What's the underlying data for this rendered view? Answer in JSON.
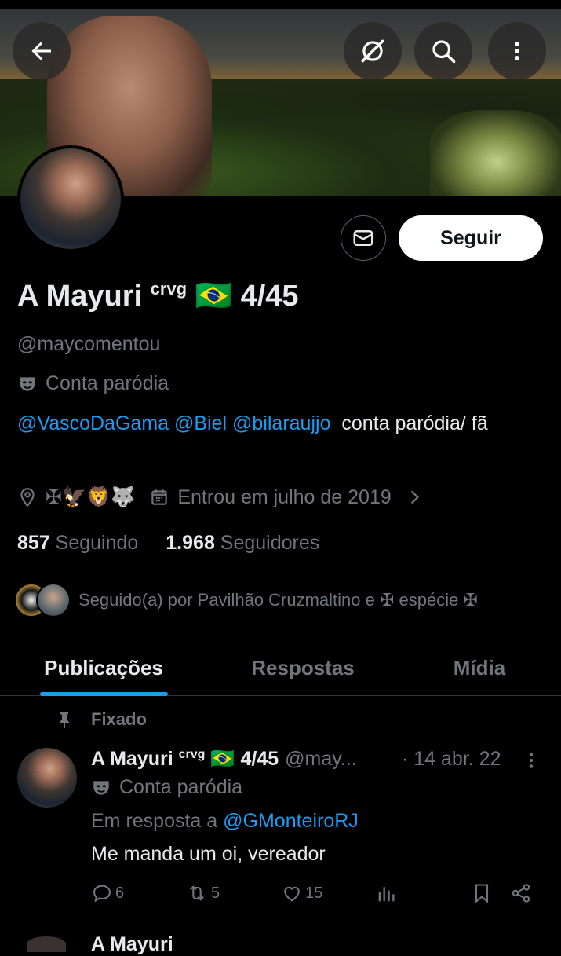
{
  "profile": {
    "name": "A Mayuri",
    "name_sup": "crvg",
    "name_flag": "🇧🇷",
    "name_suffix": "4/45",
    "handle": "@maycomentou",
    "parody_label": "Conta paródia",
    "bio_links": [
      "@VascoDaGama",
      "@Biel",
      "@bilaraujjo"
    ],
    "bio_text": "conta paródia/ fã",
    "location_emojis": "✠🦅🦁🐺",
    "joined": "Entrou em julho de 2019",
    "following_count": "857",
    "following_label": "Seguindo",
    "followers_count": "1.968",
    "followers_label": "Seguidores",
    "followed_by": "Seguido(a) por Pavilhão Cruzmaltino e ✠ espécie ✠"
  },
  "actions": {
    "follow_label": "Seguir"
  },
  "tabs": [
    {
      "label": "Publicações",
      "active": true
    },
    {
      "label": "Respostas",
      "active": false
    },
    {
      "label": "Mídia",
      "active": false
    }
  ],
  "pinned_post": {
    "pinned_label": "Fixado",
    "author": "A Mayuri",
    "author_sup": "crvg",
    "author_flag": "🇧🇷",
    "author_suffix": "4/45",
    "handle": "@may...",
    "date": "· 14 abr. 22",
    "parody_label": "Conta paródia",
    "reply_prefix": "Em resposta a",
    "reply_to": "@GMonteiroRJ",
    "text": "Me manda um oi, vereador",
    "replies": "6",
    "reposts": "5",
    "likes": "15"
  },
  "next_post": {
    "author_partial": "A Mayuri"
  },
  "colors": {
    "accent": "#1d9bf0",
    "muted": "#71767b",
    "text": "#e7e9ea",
    "background": "#000000"
  }
}
